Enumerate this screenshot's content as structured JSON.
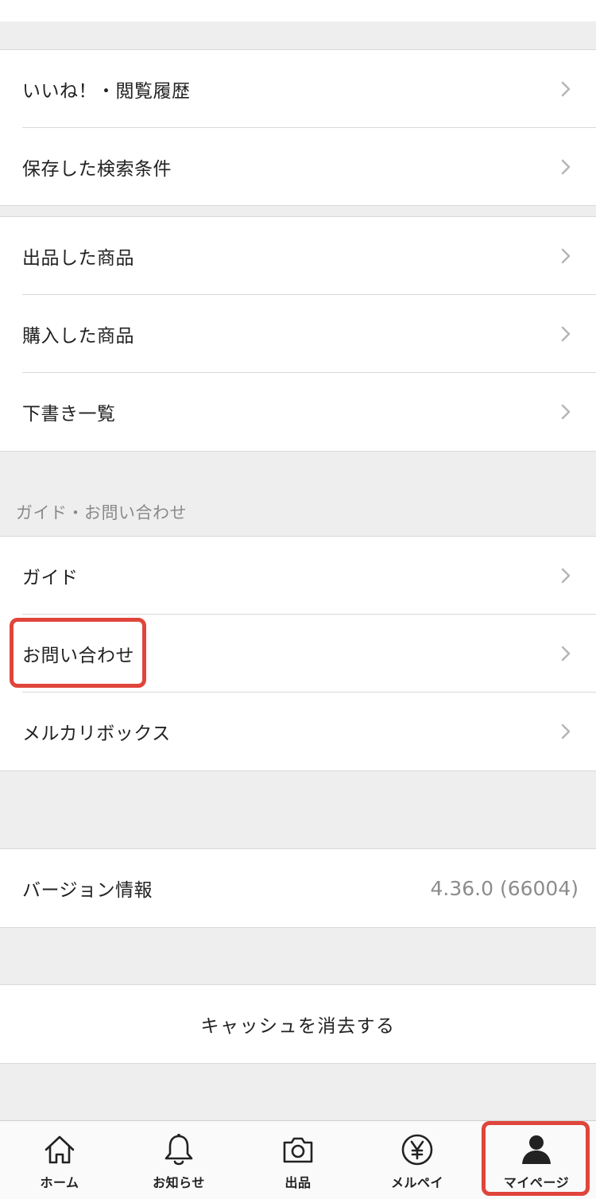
{
  "menu_group_1": [
    {
      "label": "いいね！・閲覧履歴"
    },
    {
      "label": "保存した検索条件"
    }
  ],
  "menu_group_2": [
    {
      "label": "出品した商品"
    },
    {
      "label": "購入した商品"
    },
    {
      "label": "下書き一覧"
    }
  ],
  "guide_section": {
    "header": "ガイド・お問い合わせ",
    "items": [
      {
        "label": "ガイド"
      },
      {
        "label": "お問い合わせ"
      },
      {
        "label": "メルカリボックス"
      }
    ]
  },
  "version": {
    "label": "バージョン情報",
    "value": "4.36.0 (66004)"
  },
  "cache": {
    "label": "キャッシュを消去する"
  },
  "tab_bar": {
    "tabs": [
      {
        "label": "ホーム",
        "icon": "home-icon"
      },
      {
        "label": "お知らせ",
        "icon": "bell-icon"
      },
      {
        "label": "出品",
        "icon": "camera-icon"
      },
      {
        "label": "メルペイ",
        "icon": "yen-icon"
      },
      {
        "label": "マイページ",
        "icon": "person-icon",
        "active": true
      }
    ]
  },
  "colors": {
    "highlight": "#e0453b",
    "background": "#eeeeee",
    "chevron": "#b5b5b5"
  }
}
